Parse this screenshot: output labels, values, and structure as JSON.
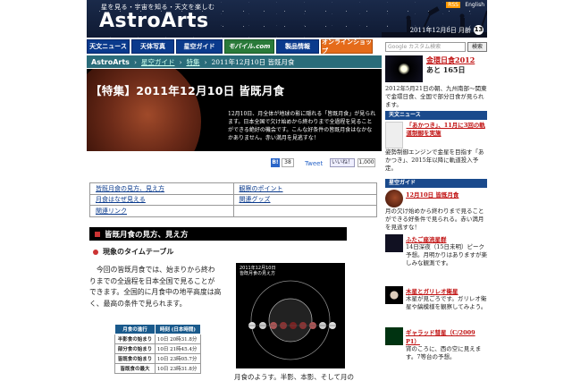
{
  "header": {
    "tagline": "星を見る・宇宙を知る・天文を楽しむ",
    "logo": "AstroArts",
    "rss": "RSS",
    "english": "English",
    "date": "2011年12月8日 月齢",
    "moon_age": "13"
  },
  "nav": [
    "天文ニュース",
    "天体写真",
    "星空ガイド",
    "モバイル.com",
    "製品情報",
    "オンラインショップ"
  ],
  "search": {
    "placeholder": "Google カスタム検索",
    "button": "検索"
  },
  "breadcrumb": {
    "brand": "AstroArts",
    "items": [
      "星空ガイド",
      "特集"
    ],
    "current": "2011年12月10日 皆既月食"
  },
  "hero": {
    "title": "【特集】2011年12月10日 皆既月食",
    "text": "12月10日、月全体が地球の影に隠れる「皆既月食」が見られます。日本全国で欠け始めから終わりまで全過程を見ることができる絶好の機会です。こんな好条件の皆既月食はなかなかありません。赤い満月を見逃すな！"
  },
  "social": {
    "b_count": "38",
    "tweet": "Tweet",
    "like": "いいね！",
    "like_count": "1,000"
  },
  "toc": [
    [
      "皆既月食の見方、見え方",
      "観察のポイント"
    ],
    [
      "月食はなぜ見える",
      "関連グッズ"
    ],
    [
      "関連リンク",
      ""
    ]
  ],
  "section": {
    "title": "皆既月食の見方、見え方",
    "subtitle": "現象のタイムテーブル"
  },
  "body": "今回の皆既月食では、始まりから終わりまでの全過程を日本全国で見ることができます。全国的に月食中の地平高度は高く、最高の条件で見られます。",
  "timetable": {
    "headers": [
      "月食の進行",
      "時刻\n(日本時間)"
    ],
    "rows": [
      [
        "半影食の始まり",
        "10日 20時31.8分"
      ],
      [
        "部分食の始まり",
        "10日 21時45.4分"
      ],
      [
        "皆既食の始まり",
        "10日 23時05.7分"
      ],
      [
        "皆既食の最大",
        "10日 23時31.8分"
      ]
    ]
  },
  "diagram": {
    "title": "2011年12月10日\n皆既月食の見え方",
    "caption": "月食のようす。半影、本影、そして月の位置を示し"
  },
  "sidebar": {
    "countdown_title": "金環日食2012",
    "countdown_days": "あと 165日",
    "countdown_text": "2012年5月21日の朝、九州南部～関東で金環日食、全国で部分日食が見られます。",
    "news_head": "天文ニュース",
    "news_link": "「あかつき」、11月に3回の軌道制御を実施",
    "news_text": "姿勢制御エンジンで金星を目指す「あかつき」、2015年以降に軌道投入予定。",
    "guide_head": "星空ガイド",
    "guide_link": "12月10日 皆既月食",
    "guide_text": "月の欠け始めから終わりまで見ることができる好条件で見られる。赤い満月を見逃すな！",
    "item1_link": "ふたご座流星群",
    "item1_text": "14日深夜（15日未明）ピーク予想。月明かりはありますが楽しみな観測です。",
    "item2_link": "木星とガリレオ衛星",
    "item2_text": "木星が見ごろです。ガリレオ衛星や縞模様を観察してみよう。",
    "item3_link": "ギャラッド彗星（C/2009 P1）",
    "item3_text": "宵のころに、西の空に見えます。7等台の予想。"
  }
}
